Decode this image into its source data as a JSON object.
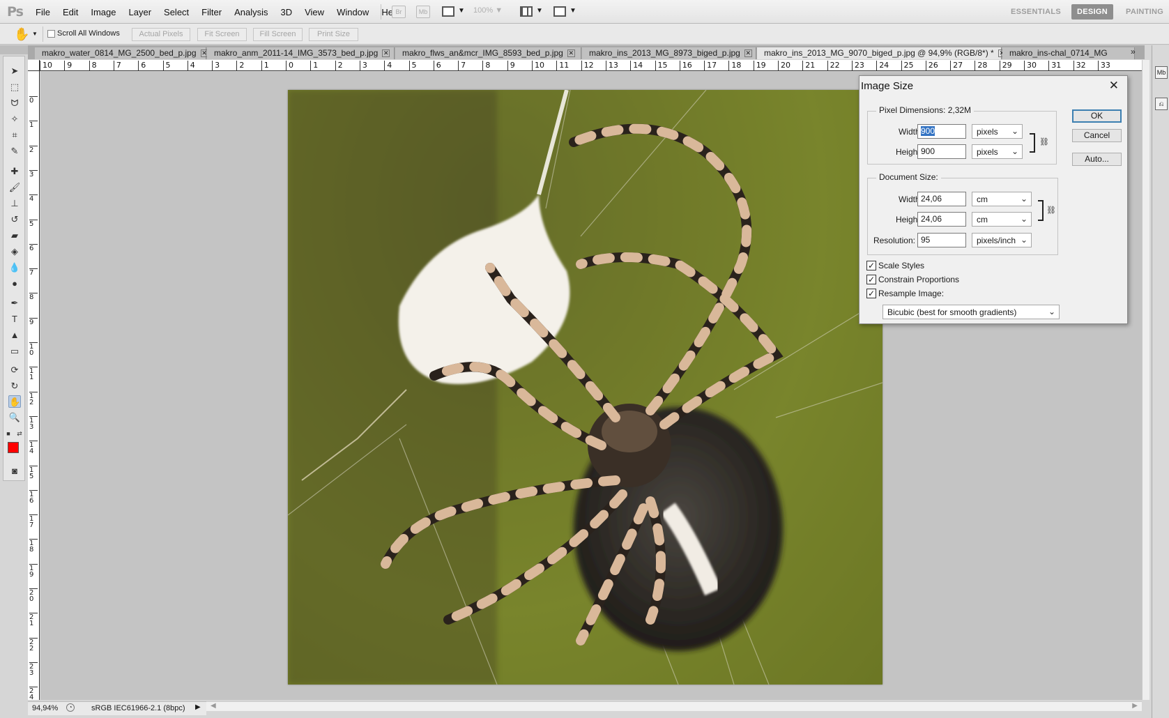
{
  "menubar": {
    "logo": "Ps",
    "items": [
      "File",
      "Edit",
      "Image",
      "Layer",
      "Select",
      "Filter",
      "Analysis",
      "3D",
      "View",
      "Window",
      "Help"
    ],
    "bridge": "Br",
    "minibridge": "Mb",
    "zoom": "100%",
    "workspaces": [
      "ESSENTIALS",
      "DESIGN",
      "PAINTING"
    ],
    "active_workspace": "DESIGN"
  },
  "options": {
    "scroll_all": "Scroll All Windows",
    "buttons": [
      "Actual Pixels",
      "Fit Screen",
      "Fill Screen",
      "Print Size"
    ]
  },
  "tabs": [
    {
      "label": "makro_water_0814_MG_2500_bed_p.jpg"
    },
    {
      "label": "makro_anm_2011-14_IMG_3573_bed_p.jpg"
    },
    {
      "label": "makro_flws_an&mcr_IMG_8593_bed_p.jpg"
    },
    {
      "label": "makro_ins_2013_MG_8973_biged_p.jpg"
    },
    {
      "label": "makro_ins_2013_MG_9070_biged_p.jpg @ 94,9% (RGB/8*) *"
    },
    {
      "label": "makro_ins-chal_0714_MG"
    }
  ],
  "ruler": {
    "h": [
      "10",
      "9",
      "8",
      "7",
      "6",
      "5",
      "4",
      "3",
      "2",
      "1",
      "0",
      "1",
      "2",
      "3",
      "4",
      "5",
      "6",
      "7",
      "8",
      "9",
      "10",
      "11",
      "12",
      "13",
      "14",
      "15",
      "16",
      "17",
      "18",
      "19",
      "20",
      "21",
      "22",
      "23",
      "24",
      "25",
      "26",
      "27",
      "28",
      "29",
      "30",
      "31",
      "32",
      "33"
    ],
    "v": [
      "0",
      "1",
      "2",
      "3",
      "4",
      "5",
      "6",
      "7",
      "8",
      "9",
      "10",
      "11",
      "12",
      "13",
      "14",
      "15",
      "16",
      "17",
      "18",
      "19",
      "20",
      "21",
      "22",
      "23",
      "24"
    ]
  },
  "status": {
    "zoom": "94,94%",
    "profile": "sRGB IEC61966-2.1 (8bpc)"
  },
  "dialog": {
    "title": "Image Size",
    "pixel_dimensions": "Pixel Dimensions:  2,32M",
    "px_width_label": "Width:",
    "px_width": "900",
    "px_width_unit": "pixels",
    "px_height_label": "Height:",
    "px_height": "900",
    "px_height_unit": "pixels",
    "document_size": "Document Size:",
    "doc_width_label": "Width:",
    "doc_width": "24,06",
    "doc_width_unit": "cm",
    "doc_height_label": "Height:",
    "doc_height": "24,06",
    "doc_height_unit": "cm",
    "resolution_label": "Resolution:",
    "resolution": "95",
    "resolution_unit": "pixels/inch",
    "scale_styles": "Scale Styles",
    "constrain": "Constrain Proportions",
    "resample": "Resample Image:",
    "resample_method": "Bicubic (best for smooth gradients)",
    "ok": "OK",
    "cancel": "Cancel",
    "auto": "Auto..."
  },
  "colors": {
    "foreground": "#ff0000",
    "background": "#ffffff"
  }
}
